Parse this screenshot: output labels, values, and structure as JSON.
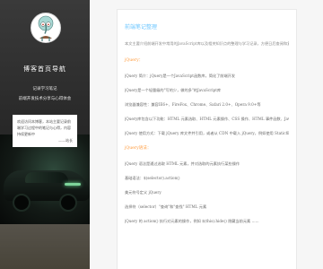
{
  "sidebar": {
    "site_title": "博客首页导航",
    "meta_line_1": "记录学习笔记",
    "meta_line_2": "前端开发技术分享与心得体会",
    "notice": "欢迎访问本博客，本站主要记录前端学习过程中的笔记与心得，内容持续更新中",
    "notice_tail": "——站长"
  },
  "article": {
    "title": "前端笔记整理",
    "intro": "本文主要介绍前端开发中常用的JavaScript库以及相关知识点的整理与学习记录，方便日后查阅和复习使用。",
    "section_1": "jQuery：",
    "lines_1": [
      "jQuery 简介：jQuery是一个JavaScript函数库，简化了前端开发",
      "jQuery是一个轻量级的\"写的少，做的多\"的JavaScript库",
      "浏览器兼容性：兼容IE6+、FireFox、Chrome、Safari 2.0+、Opera 9.0+等",
      "jQuery库包含以下功能：HTML 元素选取、HTML 元素操作、CSS 操作、HTML 事件函数、JavaScript 特效和动画、AJAX、Utilities",
      "jQuery 使用方式：下载 jQuery 库文件并引用，或者从 CDN 中载入 jQuery，例如使用 Staticfile CDN"
    ],
    "section_2": "jQuery语法：",
    "lines_2": [
      "jQuery 语法是通过选取 HTML 元素，并对选取的元素执行某些操作",
      "基础语法：$(selector).action()",
      "美元符号定义 jQuery",
      "选择符（selector）\"查询\"和\"查找\" HTML 元素",
      "jQuery 的 action() 执行对元素的操作，例如 $(this).hide() 隐藏当前元素 ......"
    ]
  }
}
